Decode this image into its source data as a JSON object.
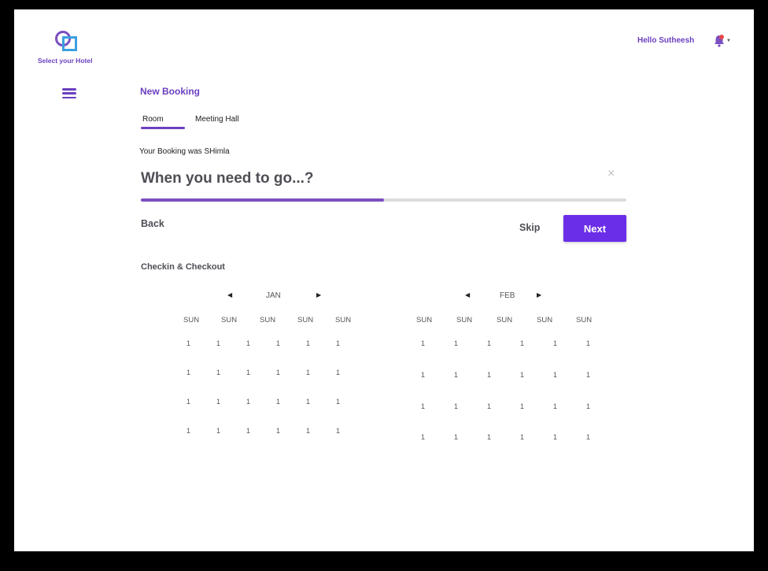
{
  "brand": {
    "logo_text": "Select your Hotel"
  },
  "header": {
    "greeting": "Hello Sutheesh"
  },
  "page": {
    "title": "New Booking",
    "tabs": [
      {
        "label": "Room",
        "active": true
      },
      {
        "label": "Meeting Hall",
        "active": false
      }
    ],
    "booking_info": "Your Booking was SHimla",
    "question": "When you need to go...?",
    "close_icon": "×",
    "progress": 0.5,
    "back_label": "Back",
    "skip_label": "Skip",
    "next_label": "Next",
    "section_label": "Checkin & Checkout"
  },
  "calendars": [
    {
      "month": "JAN",
      "weekdays": [
        "SUN",
        "SUN",
        "SUN",
        "SUN",
        "SUN"
      ],
      "weeks": [
        [
          "1",
          "1",
          "1",
          "1",
          "1",
          "1"
        ],
        [
          "1",
          "1",
          "1",
          "1",
          "1",
          "1"
        ],
        [
          "1",
          "1",
          "1",
          "1",
          "1",
          "1"
        ],
        [
          "1",
          "1",
          "1",
          "1",
          "1",
          "1"
        ]
      ]
    },
    {
      "month": "FEB",
      "weekdays": [
        "SUN",
        "SUN",
        "SUN",
        "SUN",
        "SUN"
      ],
      "weeks": [
        [
          "1",
          "1",
          "1",
          "1",
          "1",
          "1"
        ],
        [
          "1",
          "1",
          "1",
          "1",
          "1",
          "1"
        ],
        [
          "1",
          "1",
          "1",
          "1",
          "1",
          "1"
        ],
        [
          "1",
          "1",
          "1",
          "1",
          "1",
          "1"
        ]
      ]
    }
  ],
  "colors": {
    "accent": "#6a3fbf",
    "button": "#6a2ee8",
    "progress_track": "#dcdcdc"
  }
}
